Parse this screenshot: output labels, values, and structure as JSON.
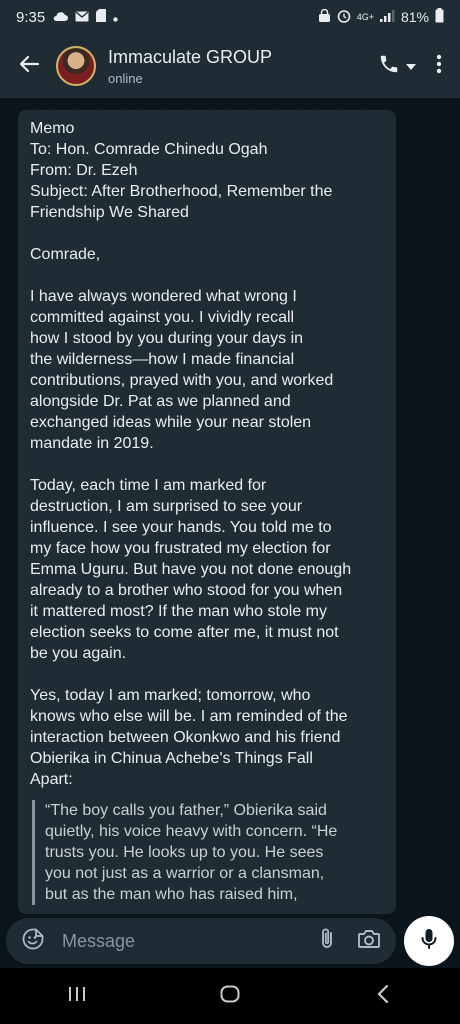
{
  "status_bar": {
    "time": "9:35",
    "battery": "81%",
    "network": "4G+"
  },
  "header": {
    "title": "Immaculate GROUP",
    "subtitle": "online"
  },
  "message": {
    "lines_block1": [
      "Memo",
      "To: Hon. Comrade Chinedu Ogah",
      "From: Dr. Ezeh",
      "Subject: After Brotherhood, Remember the",
      "Friendship We Shared"
    ],
    "salutation": "Comrade,",
    "para1": [
      "I have always wondered what wrong I",
      "committed against you. I vividly recall",
      "how I stood by you during your days in",
      "the wilderness—how I made financial",
      "contributions, prayed with you, and worked",
      "alongside Dr. Pat as we planned and",
      "exchanged ideas while your near stolen",
      "mandate in 2019."
    ],
    "para2": [
      "Today, each time I am marked for",
      "destruction, I am surprised to see your",
      "influence. I see your hands. You told me to",
      "my face how you frustrated my election for",
      "Emma Uguru. But have you not done enough",
      "already to a brother who stood for you when",
      "it mattered most? If the man who stole my",
      "election seeks to come after me, it must not",
      "be you again."
    ],
    "para3": [
      "Yes, today I am marked; tomorrow, who",
      "knows who else will be. I am reminded of the",
      "interaction between Okonkwo and his friend",
      "Obierika in Chinua Achebe's Things Fall",
      "Apart:"
    ],
    "quote": [
      "“The boy calls you father,” Obierika said",
      "quietly, his voice heavy with concern. “He",
      "trusts you. He looks up to you. He sees",
      "you not just as a warrior or a clansman,",
      "but as the man who has raised him,"
    ]
  },
  "composer": {
    "placeholder": "Message"
  },
  "icons": {
    "back": "arrow-left-icon",
    "call": "phone-icon",
    "menu": "more-vertical-icon",
    "emoji": "emoji-icon",
    "attach": "paperclip-icon",
    "camera": "camera-icon",
    "mic": "microphone-icon"
  },
  "colors": {
    "background": "#0b141a",
    "bar": "#1f2c34",
    "bubble": "#202c33",
    "text": "#e9edef",
    "muted": "#8696a0"
  }
}
